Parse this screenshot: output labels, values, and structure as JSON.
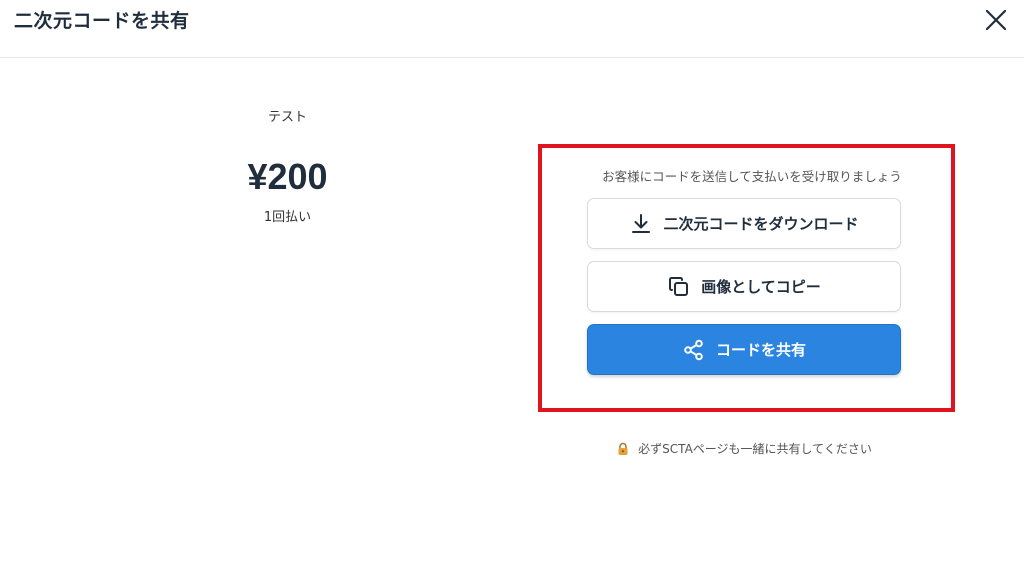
{
  "header": {
    "title": "二次元コードを共有"
  },
  "product": {
    "name": "テスト",
    "price": "¥200",
    "frequency": "1回払い"
  },
  "share": {
    "hint": "お客様にコードを送信して支払いを受け取りましょう",
    "download_label": "二次元コードをダウンロード",
    "copy_label": "画像としてコピー",
    "share_label": "コードを共有"
  },
  "notice": {
    "text": "必ずSCTAページも一緒に共有してください"
  },
  "colors": {
    "primary": "#2a84e0",
    "highlight": "#e0141e",
    "text": "#1f2d3d"
  }
}
